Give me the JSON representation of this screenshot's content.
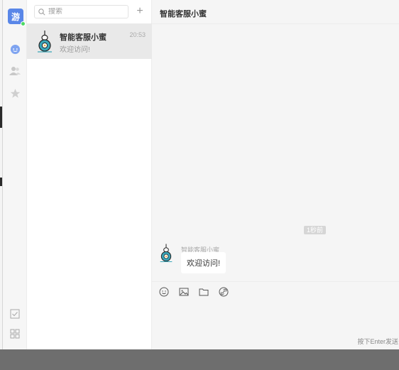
{
  "nav": {
    "avatar_text": "游",
    "items": [
      "chat-icon",
      "contacts-icon",
      "star-icon"
    ],
    "bottom_items": [
      "checkbox-icon",
      "apps-grid-icon"
    ]
  },
  "list": {
    "search_placeholder": "搜索",
    "add_label": "+",
    "conversations": [
      {
        "name": "智能客服小蜜",
        "time": "20:53",
        "last_message": "欢迎访问!"
      }
    ]
  },
  "chat": {
    "title": "智能客服小蜜",
    "time_tag": "1秒前",
    "message": {
      "sender": "智能客服小蜜",
      "text": "欢迎访问!"
    },
    "toolbar": [
      "emoji-icon",
      "image-icon",
      "folder-icon",
      "link-icon"
    ],
    "send_hint": "按下Enter发送"
  },
  "colors": {
    "accent": "#5a87e8",
    "online": "#4cd964",
    "bot_body": "#3aa6b9"
  }
}
